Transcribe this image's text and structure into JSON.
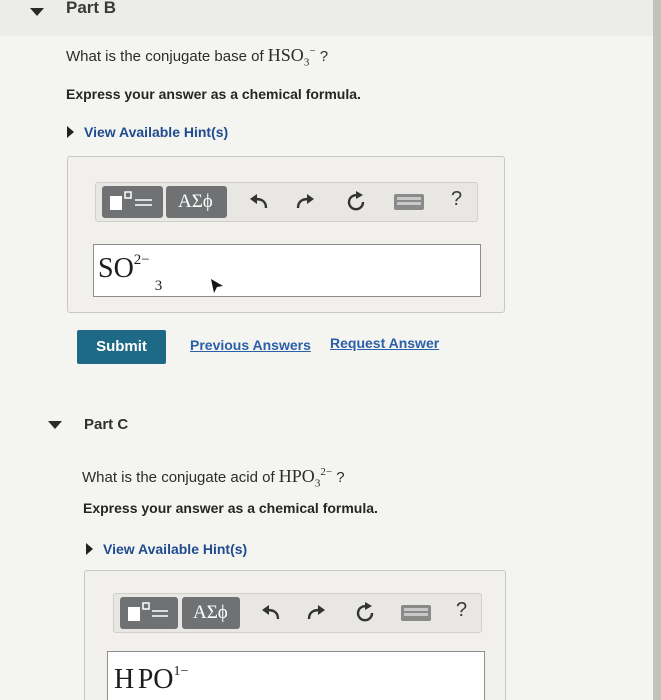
{
  "part_b": {
    "title": "Part B",
    "question_text": "What is the conjugate base of",
    "species": {
      "base": "HSO",
      "sub": "3",
      "sup": "−"
    },
    "question_end": "?",
    "instruction": "Express your answer as a chemical formula.",
    "hint_label": "View Available Hint(s)",
    "toolbar": {
      "greek_label": "ΑΣϕ",
      "help_label": "?"
    },
    "answer": {
      "base": "SO",
      "sup": "2−",
      "sub": "3"
    },
    "submit_label": "Submit",
    "previous_answers_label": "Previous Answers",
    "request_answer_label": "Request Answer"
  },
  "part_c": {
    "title": "Part C",
    "question_text": "What is the conjugate acid of",
    "species": {
      "base": "HPO",
      "sub": "3",
      "sup": "2−"
    },
    "question_end": "?",
    "instruction": "Express your answer as a chemical formula.",
    "hint_label": "View Available Hint(s)",
    "toolbar": {
      "greek_label": "ΑΣϕ",
      "help_label": "?"
    },
    "answer": {
      "base_h": "H",
      "base_rest": "PO",
      "sup": "1−"
    }
  },
  "icons": [
    "templates-icon",
    "undo-icon",
    "redo-icon",
    "reset-icon",
    "keyboard-icon",
    "help-icon",
    "cursor-icon"
  ]
}
